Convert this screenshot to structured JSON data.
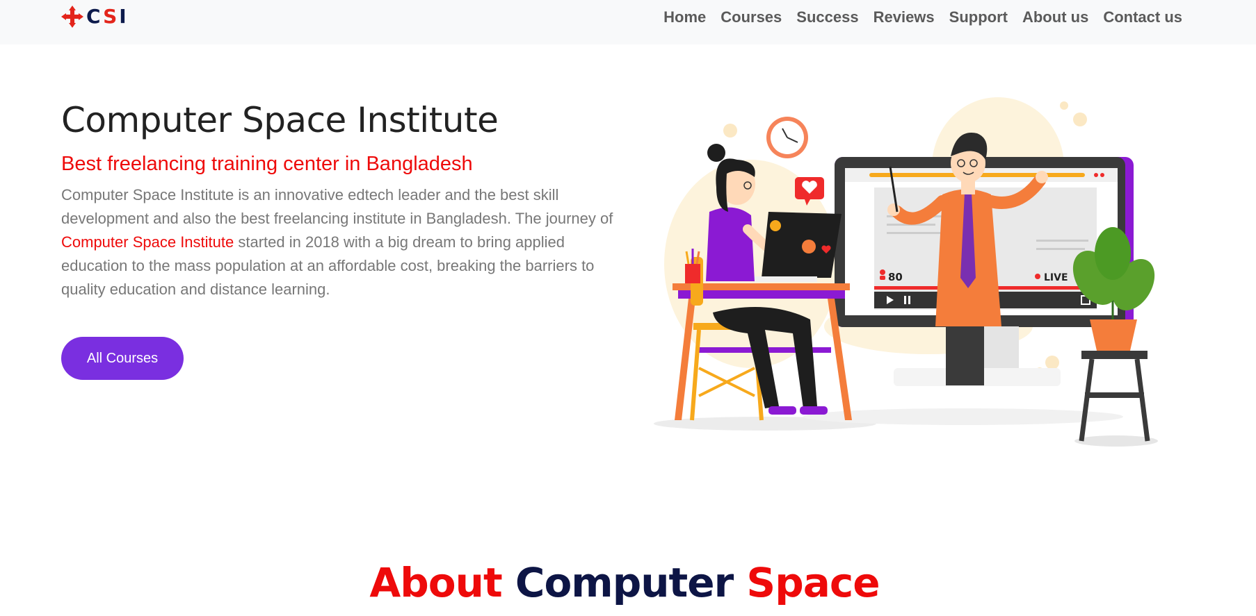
{
  "logo": {
    "letters": [
      "C",
      "S",
      "I"
    ]
  },
  "nav": {
    "items": [
      "Home",
      "Courses",
      "Success",
      "Reviews",
      "Support",
      "About us",
      "Contact us"
    ]
  },
  "hero": {
    "title": "Computer Space Institute",
    "subtitle": "Best freelancing training center in Bangladesh",
    "desc_part1": "Computer Space Institute is an innovative edtech leader and the best skill development and also the best freelancing institute in Bangladesh. The journey of ",
    "desc_highlight": "Computer Space Institute",
    "desc_part2": " started in 2018 with a big dream to bring applied education to the mass population at an affordable cost, breaking the barriers to quality education and distance learning.",
    "button_label": "All Courses"
  },
  "illustration": {
    "viewer_count": "80",
    "live_label": "LIVE"
  },
  "about": {
    "word1": "About",
    "word2": "Computer",
    "word3": "Space"
  },
  "colors": {
    "accent_red": "#ee0a0a",
    "button_purple": "#7a2fe0",
    "navy": "#0d1545",
    "navbar_bg": "#f8f9fa"
  }
}
